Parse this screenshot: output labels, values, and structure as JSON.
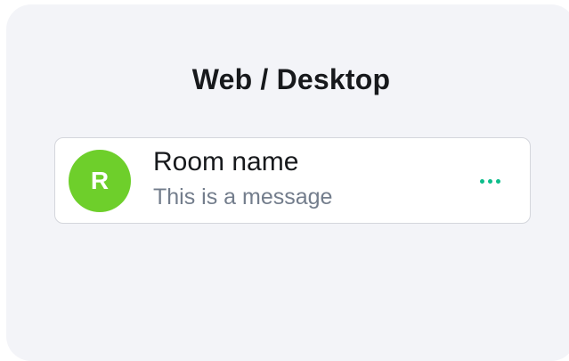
{
  "header": {
    "title": "Web / Desktop"
  },
  "room_tile": {
    "avatar_letter": "R",
    "name": "Room name",
    "message": "This is a message",
    "menu_icon": "more-horizontal-icon"
  },
  "colors": {
    "background": "#f3f4f8",
    "avatar": "#6ecf2b",
    "accent": "#0dbd8b",
    "primary_text": "#17191c",
    "secondary_text": "#737d8c"
  }
}
